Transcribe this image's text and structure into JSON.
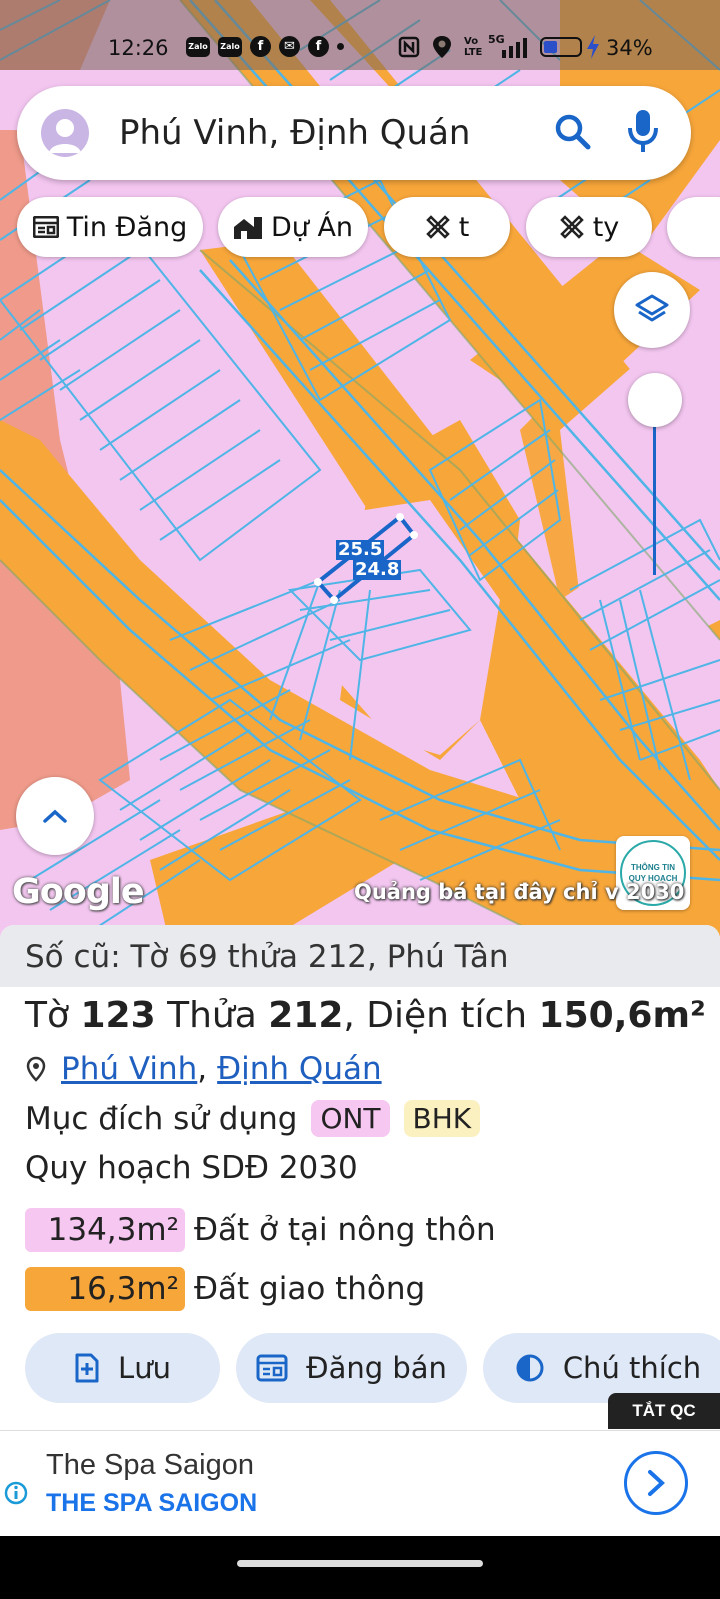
{
  "status_bar": {
    "time": "12:26",
    "app_icons": [
      "Zalo",
      "Zalo"
    ],
    "battery_percent": "34%",
    "network": "5G",
    "volte": "Vo LTE"
  },
  "search": {
    "query": "Phú Vinh, Định Quán"
  },
  "chips": [
    {
      "label": "Tin Đăng",
      "icon": "newspaper-icon"
    },
    {
      "label": "Dự Án",
      "icon": "buildings-icon"
    },
    {
      "label": "t",
      "icon": "ruler-pencil-icon"
    },
    {
      "label": "ty",
      "icon": "ruler-pencil-icon"
    }
  ],
  "map": {
    "dimension_labels": [
      "25.5",
      "24.8"
    ],
    "google_logo": "Google",
    "ad_text": "Quảng bá tại đây chỉ v 2030",
    "plan_badge_line1": "THÔNG TIN",
    "plan_badge_line2": "QUY HOẠCH",
    "colors": {
      "residential_rural": "#f3c6f0",
      "traffic": "#f7a63a",
      "parcel_lines": "#4fb5e6",
      "other_land": "#ef9a8a"
    }
  },
  "parcel": {
    "old_number": "Số cũ: Tờ 69 thửa 212, Phú Tân",
    "sheet_label": "Tờ",
    "sheet": "123",
    "lot_label": "Thửa",
    "lot": "212",
    "area_label": ", Diện tích",
    "area": "150,6m²",
    "commune": "Phú Vinh",
    "district": "Định Quán",
    "purpose_label": "Mục đích sử dụng",
    "purpose_tags": [
      "ONT",
      "BHK"
    ],
    "plan_title": "Quy hoạch SDĐ 2030",
    "plan_rows": [
      {
        "area": "134,3m²",
        "label": "Đất ở tại nông thôn",
        "color": "#f6c7f1"
      },
      {
        "area": "16,3m²",
        "label": "Đất giao thông",
        "color": "#f7a63a"
      }
    ]
  },
  "actions": [
    {
      "label": "Lưu",
      "icon": "save-plus-icon"
    },
    {
      "label": "Đăng bán",
      "icon": "listing-icon"
    },
    {
      "label": "Chú thích",
      "icon": "contrast-icon"
    }
  ],
  "close_ads_label": "TẮT QC",
  "ad": {
    "name": "The Spa Saigon",
    "brand": "THE SPA SAIGON"
  }
}
